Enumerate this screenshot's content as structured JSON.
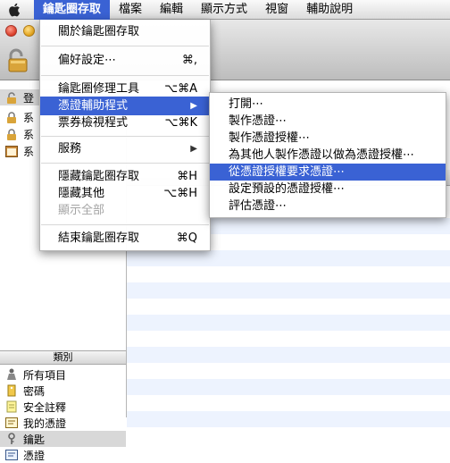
{
  "menubar": {
    "apple_icon": "apple-logo-icon",
    "items": [
      "鑰匙圈存取",
      "檔案",
      "編輯",
      "顯示方式",
      "視窗",
      "輔助說明"
    ]
  },
  "app_menu": {
    "items": [
      {
        "label": "關於鑰匙圈存取",
        "shortcut": ""
      },
      {
        "label": "偏好設定⋯",
        "shortcut": "⌘,"
      },
      {
        "label": "鑰匙圈修理工具",
        "shortcut": "⌥⌘A"
      },
      {
        "label": "憑證輔助程式",
        "shortcut": "",
        "submenu_arrow": "▶"
      },
      {
        "label": "票券檢視程式",
        "shortcut": "⌥⌘K"
      },
      {
        "label": "服務",
        "shortcut": "",
        "submenu_arrow": "▶"
      },
      {
        "label": "隱藏鑰匙圈存取",
        "shortcut": "⌘H"
      },
      {
        "label": "隱藏其他",
        "shortcut": "⌥⌘H"
      },
      {
        "label": "顯示全部",
        "shortcut": ""
      },
      {
        "label": "結束鑰匙圈存取",
        "shortcut": "⌘Q"
      }
    ]
  },
  "certificate_submenu": {
    "items": [
      "打開⋯",
      "製作憑證⋯",
      "製作憑證授權⋯",
      "為其他人製作憑證以做為憑證授權⋯",
      "從憑證授權要求憑證⋯",
      "設定預設的憑證授權⋯",
      "評估憑證⋯"
    ]
  },
  "sidebar": {
    "keychains_partial": [
      "登",
      "系",
      "系",
      "系"
    ],
    "category_header": "類別",
    "categories": [
      "所有項目",
      "密碼",
      "安全註釋",
      "我的憑證",
      "鑰匙",
      "憑證"
    ],
    "selected_category": "鑰匙"
  },
  "colors": {
    "highlight": "#3a62d4",
    "stripe": "#edf3fe"
  }
}
